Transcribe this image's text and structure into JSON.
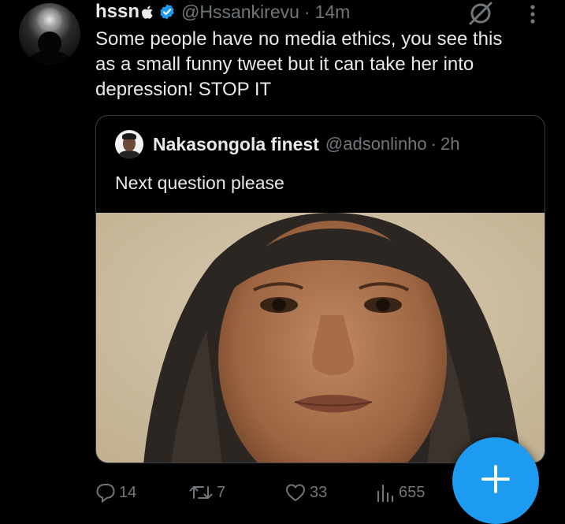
{
  "tweet": {
    "display_name": "hssn",
    "handle": "@Hssankirevu",
    "separator": "·",
    "time": "14m",
    "text": "Some people have no media ethics, you see this\nas a small funny tweet but it can take her into\ndepression! STOP IT"
  },
  "quoted": {
    "display_name": "Nakasongola finest",
    "handle": "@adsonlinho",
    "separator": "·",
    "time": "2h",
    "text": "Next question please"
  },
  "actions": {
    "replies": "14",
    "reposts": "7",
    "likes": "33",
    "views": "655"
  },
  "colors": {
    "background": "#000000",
    "text": "#e7e9ea",
    "muted": "#71767b",
    "accent": "#1d9bf0"
  },
  "icons": {
    "verified": "verified-badge-icon",
    "grok": "grok-icon",
    "more": "more-options-icon",
    "reply": "reply-icon",
    "repost": "repost-icon",
    "like": "heart-icon",
    "views": "views-icon",
    "compose": "plus-icon"
  }
}
